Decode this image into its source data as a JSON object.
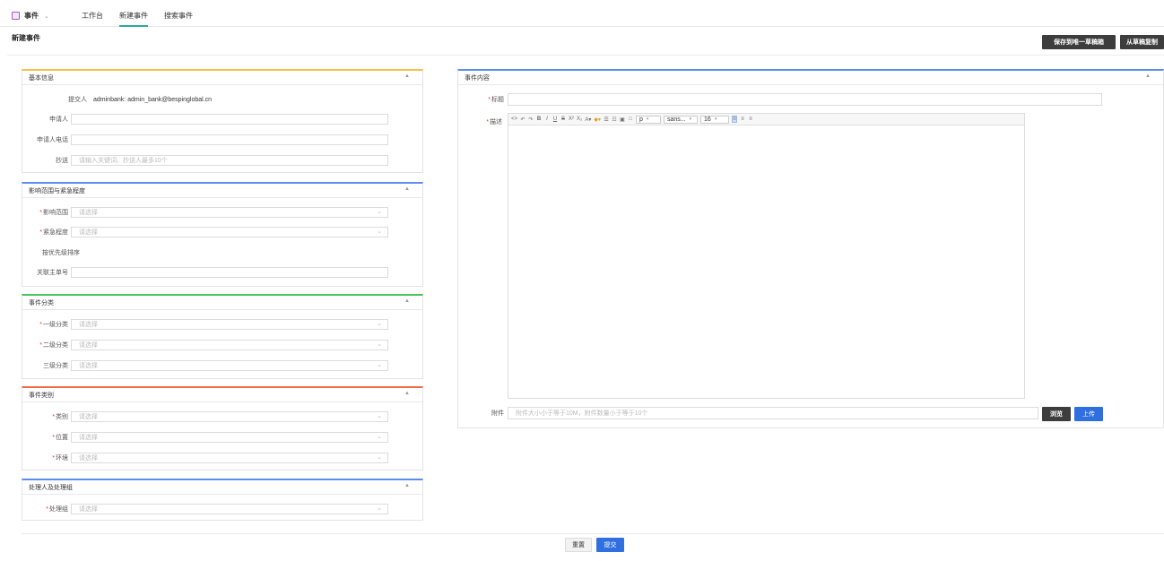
{
  "nav": {
    "brand": "事件",
    "caret": "⌄",
    "tabs": [
      "工作台",
      "新建事件",
      "搜索事件"
    ]
  },
  "page": {
    "title": "新建事件",
    "save_draft_button": "保存到唯一草稿箱",
    "copy_draft_button": "从草稿复制"
  },
  "basic": {
    "title": "基本信息",
    "submitter_label": "提交人",
    "submitter_value": "adminbank: admin_bank@bespinglobal.cn",
    "applicant_label": "申请人",
    "applicant_phone_label": "申请人电话",
    "cc_label": "抄送",
    "cc_placeholder": "请输入关键词、抄送人最多10个"
  },
  "impact": {
    "title": "影响范围与紧急程度",
    "scope_label": "影响范围",
    "urgency_label": "紧急程度",
    "priority_label": "按优先级排序",
    "related_label": "关联主单号",
    "select_placeholder": "请选择"
  },
  "category": {
    "title": "事件分类",
    "level1_label": "一级分类",
    "level2_label": "二级分类",
    "level3_label": "三级分类",
    "select_placeholder": "请选择"
  },
  "type": {
    "title": "事件类别",
    "type_label": "类别",
    "location_label": "位置",
    "env_label": "环境",
    "select_placeholder": "请选择"
  },
  "handler": {
    "title": "处理人及处理组",
    "group_label": "处理组",
    "select_placeholder": "请选择"
  },
  "content": {
    "title": "事件内容",
    "subject_label": "标题",
    "desc_label": "描述",
    "toolbar": {
      "paragraph": "p",
      "font": "sans...",
      "size": "16"
    },
    "attachment_label": "附件",
    "attachment_placeholder": "附件大小小于等于10M，附件数量小于等于10个",
    "browse_button": "浏览",
    "upload_button": "上传"
  },
  "footer": {
    "reset_button": "重置",
    "submit_button": "提交"
  },
  "colors": {
    "accent_teal": "#2aa8a0",
    "panel_basic": "#f5c04a",
    "panel_impact": "#5b8def",
    "panel_category": "#4cc35a",
    "panel_type": "#f06a4a",
    "panel_handler": "#5b8def",
    "panel_content": "#5b8def",
    "primary_blue": "#2f6fe0"
  }
}
